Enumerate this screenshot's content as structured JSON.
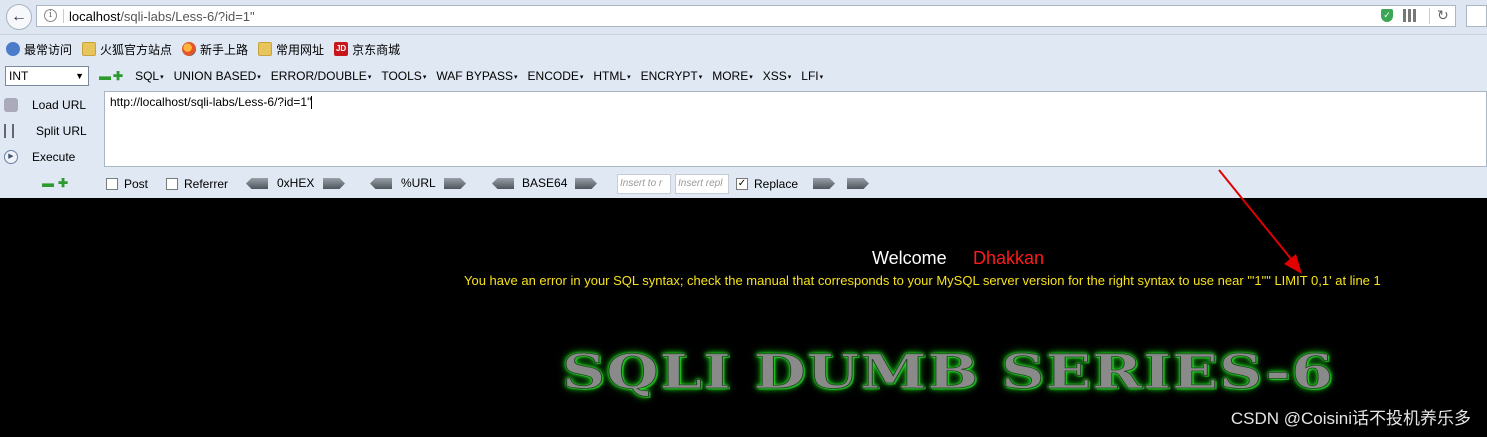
{
  "browser": {
    "url_host": "localhost",
    "url_path": "/sqli-labs/Less-6/?id=1\""
  },
  "bookmarks": [
    {
      "label": "最常访问",
      "icon": "most-visited-icon"
    },
    {
      "label": "火狐官方站点",
      "icon": "folder-icon"
    },
    {
      "label": "新手上路",
      "icon": "firefox-icon"
    },
    {
      "label": "常用网址",
      "icon": "folder-icon"
    },
    {
      "label": "京东商城",
      "icon": "jd-icon",
      "icon_text": "JD"
    }
  ],
  "hackbar": {
    "type_select": "INT",
    "menus": [
      "SQL",
      "UNION BASED",
      "ERROR/DOUBLE",
      "TOOLS",
      "WAF BYPASS",
      "ENCODE",
      "HTML",
      "ENCRYPT",
      "MORE",
      "XSS",
      "LFI"
    ],
    "commands": {
      "load": "Load URL",
      "split": "Split URL",
      "execute": "Execute"
    },
    "url_value": "http://localhost/sqli-labs/Less-6/?id=1\"",
    "post_label": "Post",
    "referrer_label": "Referrer",
    "hex_label": "0xHEX",
    "url_enc_label": "%URL",
    "base64_label": "BASE64",
    "insert_placeholder_1": "Insert to r",
    "insert_placeholder_2": "Insert repl",
    "replace_label": "Replace",
    "replace_checked": true
  },
  "page": {
    "welcome": "Welcome",
    "name": "Dhakkan",
    "error_text": "You have an error in your SQL syntax; check the manual that corresponds to your MySQL server version for the right syntax to use near '\"1\"\" LIMIT 0,1' at line 1",
    "banner": "SQLI DUMB SERIES-6",
    "watermark": "CSDN @Coisini话不投机养乐多"
  },
  "colors": {
    "welcome": "#ffffff",
    "name": "#ff1a1a",
    "error": "#f7e21b",
    "annotation_arrow": "#e00000"
  }
}
